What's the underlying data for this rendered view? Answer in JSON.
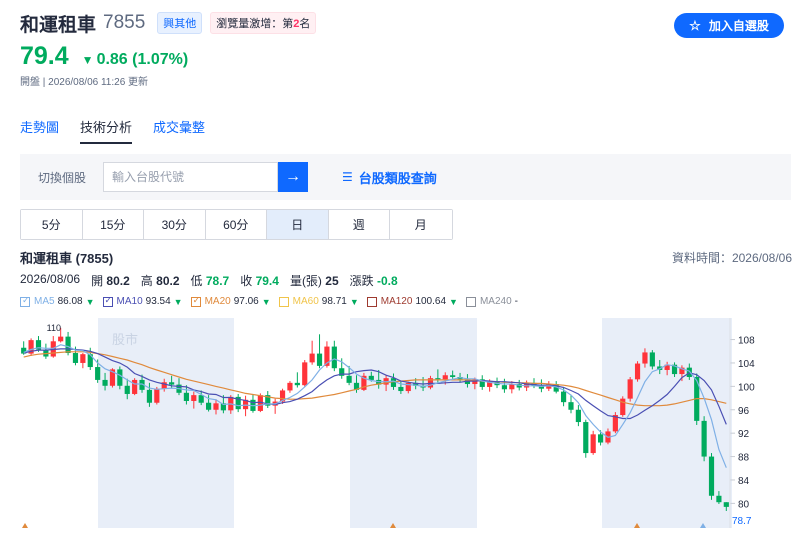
{
  "header": {
    "name": "和運租車",
    "code": "7855",
    "sector_tag": "興其他",
    "hot_prefix": "瀏覽量激增：第",
    "hot_rank": "2",
    "hot_suffix": "名",
    "watch_label": "加入自選股",
    "watch_icon": "star-icon",
    "price": "79.4",
    "change_arrow": "▼",
    "change": "0.86 (1.07%)",
    "update": "開盤 | 2026/08/06 11:26 更新"
  },
  "tabs": [
    {
      "label": "走勢圖",
      "active": false
    },
    {
      "label": "技術分析",
      "active": true
    },
    {
      "label": "成交彙整",
      "active": false
    }
  ],
  "search": {
    "label": "切換個股",
    "placeholder": "輸入台股代號",
    "button_icon": "arrow-right-icon",
    "category_link": "台股類股查詢"
  },
  "periods": [
    {
      "label": "5分",
      "active": false
    },
    {
      "label": "15分",
      "active": false
    },
    {
      "label": "30分",
      "active": false
    },
    {
      "label": "60分",
      "active": false
    },
    {
      "label": "日",
      "active": true
    },
    {
      "label": "週",
      "active": false
    },
    {
      "label": "月",
      "active": false
    }
  ],
  "chart_info": {
    "title": "和運租車 (7855)",
    "data_time": "資料時間：2026/08/06",
    "date": "2026/08/06",
    "open_label": "開",
    "open": "80.2",
    "high_label": "高",
    "high": "80.2",
    "low_label": "低",
    "low": "78.7",
    "close_label": "收",
    "close": "79.4",
    "volume_label": "量(張)",
    "volume": "25",
    "change_label": "漲跌",
    "change": "-0.8"
  },
  "ma_legend": [
    {
      "name": "MA5",
      "value": "86.08",
      "arrow": "▼",
      "color": "#7fb0e6",
      "checked": true
    },
    {
      "name": "MA10",
      "value": "93.54",
      "arrow": "▼",
      "color": "#4a4fb3",
      "checked": true
    },
    {
      "name": "MA20",
      "value": "97.06",
      "arrow": "▼",
      "color": "#e08a3c",
      "checked": true
    },
    {
      "name": "MA60",
      "value": "98.71",
      "arrow": "▼",
      "color": "#f0c44a",
      "checked": false
    },
    {
      "name": "MA120",
      "value": "100.64",
      "arrow": "▼",
      "color": "#9e3a2f",
      "checked": false
    },
    {
      "name": "MA240",
      "value": "-",
      "arrow": "",
      "color": "#8a8f99",
      "checked": false
    }
  ],
  "colors": {
    "up": "#ff333a",
    "down": "#00ab5e",
    "accent": "#0f69ff",
    "band": "#e8eef8"
  },
  "chart_data": {
    "type": "candlestick",
    "y_ticks": [
      "108",
      "104",
      "100",
      "96",
      "92",
      "88",
      "84",
      "80"
    ],
    "ylim": [
      77.5,
      111
    ],
    "last_label": "78.7",
    "max_label": "110",
    "watermark": "股市",
    "candles": [
      [
        106.6,
        107.7,
        105.4,
        105.6
      ],
      [
        105.6,
        108.2,
        105.2,
        107.9
      ],
      [
        107.9,
        108.6,
        105.9,
        106.3
      ],
      [
        106.3,
        107.3,
        104.7,
        105.1
      ],
      [
        105.1,
        108.6,
        104.9,
        107.7
      ],
      [
        107.7,
        110.0,
        107.5,
        108.5
      ],
      [
        108.5,
        109.3,
        105.3,
        105.7
      ],
      [
        105.7,
        106.8,
        103.6,
        104.0
      ],
      [
        104.0,
        105.7,
        103.1,
        105.5
      ],
      [
        105.5,
        106.6,
        102.8,
        103.3
      ],
      [
        103.3,
        104.6,
        100.6,
        101.1
      ],
      [
        101.1,
        102.3,
        99.3,
        100.1
      ],
      [
        100.1,
        103.1,
        99.8,
        102.9
      ],
      [
        102.9,
        103.4,
        99.5,
        100.1
      ],
      [
        100.1,
        101.3,
        97.8,
        98.7
      ],
      [
        98.7,
        101.4,
        98.5,
        101.1
      ],
      [
        101.1,
        102.0,
        98.9,
        99.4
      ],
      [
        99.4,
        100.6,
        96.5,
        97.2
      ],
      [
        97.2,
        99.9,
        96.9,
        99.6
      ],
      [
        99.6,
        101.3,
        99.1,
        100.7
      ],
      [
        100.7,
        101.8,
        99.8,
        100.3
      ],
      [
        100.3,
        101.4,
        98.5,
        98.9
      ],
      [
        98.9,
        100.2,
        96.9,
        97.5
      ],
      [
        97.5,
        99.1,
        96.2,
        98.5
      ],
      [
        98.5,
        99.3,
        96.8,
        97.2
      ],
      [
        97.2,
        98.5,
        95.7,
        96.0
      ],
      [
        96.0,
        97.8,
        95.2,
        97.1
      ],
      [
        97.1,
        98.5,
        95.4,
        95.9
      ],
      [
        95.9,
        98.5,
        95.3,
        98.2
      ],
      [
        98.2,
        98.7,
        95.6,
        96.1
      ],
      [
        96.1,
        98.4,
        94.9,
        97.7
      ],
      [
        97.7,
        98.6,
        95.5,
        95.8
      ],
      [
        95.8,
        98.8,
        95.6,
        98.5
      ],
      [
        98.5,
        99.2,
        96.3,
        96.7
      ],
      [
        96.7,
        97.9,
        95.3,
        97.4
      ],
      [
        97.4,
        99.6,
        97.0,
        99.3
      ],
      [
        99.3,
        100.9,
        98.9,
        100.6
      ],
      [
        100.6,
        102.4,
        99.8,
        100.2
      ],
      [
        100.2,
        104.5,
        99.9,
        104.1
      ],
      [
        104.1,
        107.8,
        103.7,
        105.6
      ],
      [
        105.6,
        108.9,
        103.1,
        103.5
      ],
      [
        103.5,
        107.7,
        103.2,
        106.8
      ],
      [
        106.8,
        107.8,
        102.6,
        103.1
      ],
      [
        103.1,
        104.8,
        101.3,
        101.8
      ],
      [
        101.8,
        103.5,
        100.2,
        100.6
      ],
      [
        100.6,
        101.9,
        98.9,
        99.4
      ],
      [
        99.4,
        102.3,
        99.2,
        101.8
      ],
      [
        101.8,
        102.5,
        100.8,
        101.1
      ],
      [
        101.1,
        102.8,
        99.6,
        100.3
      ],
      [
        100.3,
        101.9,
        99.2,
        101.4
      ],
      [
        101.4,
        102.2,
        99.4,
        99.9
      ],
      [
        99.9,
        101.0,
        98.7,
        99.2
      ],
      [
        99.2,
        100.8,
        98.8,
        100.6
      ],
      [
        100.6,
        101.4,
        99.5,
        100.1
      ],
      [
        100.1,
        101.6,
        99.2,
        99.8
      ],
      [
        99.8,
        101.8,
        99.5,
        101.4
      ],
      [
        101.4,
        102.9,
        100.6,
        101.2
      ],
      [
        101.2,
        102.4,
        100.3,
        101.9
      ],
      [
        101.9,
        102.7,
        101.3,
        101.6
      ],
      [
        101.6,
        102.3,
        100.7,
        101.2
      ],
      [
        101.2,
        102.1,
        99.8,
        100.4
      ],
      [
        100.4,
        101.5,
        99.5,
        101.2
      ],
      [
        101.2,
        101.9,
        99.4,
        99.9
      ],
      [
        99.9,
        101.2,
        99.1,
        100.8
      ],
      [
        100.8,
        101.5,
        99.7,
        100.2
      ],
      [
        100.2,
        101.3,
        98.9,
        99.5
      ],
      [
        99.5,
        100.9,
        98.8,
        100.4
      ],
      [
        100.4,
        101.1,
        99.3,
        99.8
      ],
      [
        99.8,
        101.0,
        99.2,
        100.6
      ],
      [
        100.6,
        101.4,
        99.7,
        100.1
      ],
      [
        100.1,
        101.2,
        99.0,
        99.6
      ],
      [
        99.6,
        100.9,
        99.2,
        100.4
      ],
      [
        100.4,
        100.9,
        98.8,
        99.1
      ],
      [
        99.1,
        99.9,
        96.6,
        97.3
      ],
      [
        97.3,
        98.6,
        95.4,
        96.0
      ],
      [
        96.0,
        96.8,
        93.2,
        93.9
      ],
      [
        93.9,
        94.3,
        87.8,
        88.6
      ],
      [
        88.6,
        92.4,
        88.3,
        91.8
      ],
      [
        91.8,
        92.5,
        89.9,
        90.4
      ],
      [
        90.4,
        92.8,
        90.1,
        92.3
      ],
      [
        92.3,
        95.6,
        92.0,
        95.1
      ],
      [
        95.1,
        98.3,
        94.8,
        97.9
      ],
      [
        97.9,
        101.6,
        97.4,
        101.2
      ],
      [
        101.2,
        104.3,
        100.8,
        103.9
      ],
      [
        103.9,
        106.5,
        103.2,
        105.8
      ],
      [
        105.8,
        106.2,
        102.9,
        103.4
      ],
      [
        103.4,
        104.5,
        102.1,
        102.8
      ],
      [
        102.8,
        104.2,
        101.9,
        103.7
      ],
      [
        103.7,
        104.1,
        101.6,
        102.1
      ],
      [
        102.1,
        103.6,
        100.9,
        103.2
      ],
      [
        103.2,
        103.9,
        101.1,
        101.6
      ],
      [
        101.6,
        102.2,
        93.4,
        94.1
      ],
      [
        94.1,
        94.9,
        87.2,
        88.0
      ],
      [
        88.0,
        88.6,
        80.6,
        81.3
      ],
      [
        81.3,
        82.1,
        79.9,
        80.2
      ],
      [
        80.2,
        80.2,
        78.7,
        79.4
      ]
    ],
    "ma5": [
      105.8,
      106.3,
      106.6,
      106.5,
      106.5,
      107.1,
      106.8,
      106.2,
      106.1,
      105.4,
      104.0,
      103.0,
      102.5,
      101.9,
      101.1,
      100.4,
      100.4,
      99.7,
      99.5,
      99.6,
      99.7,
      99.6,
      99.4,
      99.3,
      98.6,
      97.9,
      97.7,
      96.9,
      97.0,
      96.7,
      96.8,
      96.7,
      96.8,
      97.0,
      97.0,
      97.6,
      98.1,
      98.8,
      99.9,
      101.1,
      102.8,
      104.0,
      104.7,
      104.2,
      103.2,
      102.1,
      101.4,
      101.0,
      100.8,
      100.8,
      100.9,
      100.4,
      100.3,
      100.2,
      100.0,
      100.2,
      100.6,
      100.9,
      101.2,
      101.5,
      101.3,
      101.3,
      100.9,
      100.7,
      100.5,
      100.4,
      100.4,
      100.2,
      100.1,
      100.1,
      100.0,
      100.1,
      99.9,
      99.4,
      98.5,
      97.2,
      95.0,
      93.5,
      92.2,
      91.3,
      91.6,
      93.5,
      95.5,
      98.1,
      100.8,
      102.5,
      103.0,
      103.7,
      103.5,
      103.0,
      102.6,
      101.0,
      98.0,
      94.3,
      89.2,
      86.1
    ],
    "ma10": [
      105.7,
      106.0,
      106.2,
      106.2,
      106.3,
      106.4,
      106.4,
      106.3,
      106.2,
      106.0,
      105.6,
      105.0,
      104.4,
      104.0,
      103.3,
      102.2,
      101.7,
      101.1,
      100.7,
      100.4,
      100.1,
      100.0,
      99.9,
      99.4,
      99.1,
      98.7,
      98.6,
      98.1,
      98.1,
      97.8,
      97.6,
      97.2,
      97.3,
      97.0,
      96.9,
      97.2,
      97.4,
      97.8,
      98.4,
      99.1,
      100.2,
      101.1,
      101.8,
      102.1,
      102.1,
      102.5,
      102.7,
      102.8,
      102.5,
      101.9,
      101.5,
      100.9,
      100.7,
      100.5,
      100.4,
      100.5,
      100.5,
      100.6,
      100.7,
      100.7,
      100.9,
      100.9,
      101.0,
      100.9,
      100.8,
      100.8,
      100.7,
      100.6,
      100.4,
      100.3,
      100.2,
      100.2,
      100.1,
      99.8,
      99.3,
      98.7,
      97.6,
      96.7,
      95.8,
      95.0,
      94.8,
      94.5,
      94.5,
      95.1,
      95.9,
      96.7,
      97.6,
      98.6,
      100.0,
      101.5,
      102.3,
      102.0,
      101.0,
      99.4,
      96.6,
      93.5
    ],
    "ma20": [
      105.0,
      105.3,
      105.5,
      105.6,
      105.7,
      105.8,
      105.9,
      105.9,
      105.9,
      105.8,
      105.6,
      105.4,
      105.1,
      104.8,
      104.5,
      104.1,
      103.7,
      103.2,
      102.8,
      102.4,
      102.0,
      101.6,
      101.2,
      100.9,
      100.6,
      100.3,
      100.0,
      99.7,
      99.4,
      99.1,
      98.8,
      98.6,
      98.4,
      98.2,
      98.0,
      97.9,
      97.8,
      97.8,
      97.9,
      98.0,
      98.2,
      98.4,
      98.6,
      98.9,
      99.2,
      99.5,
      99.9,
      100.2,
      100.4,
      100.6,
      100.8,
      100.9,
      101.0,
      101.1,
      101.1,
      101.1,
      101.1,
      101.1,
      101.1,
      101.1,
      101.1,
      101.0,
      100.9,
      100.8,
      100.8,
      100.7,
      100.7,
      100.6,
      100.6,
      100.5,
      100.5,
      100.4,
      100.3,
      100.2,
      100.0,
      99.7,
      99.3,
      98.9,
      98.5,
      98.1,
      97.7,
      97.3,
      97.0,
      96.8,
      96.7,
      96.7,
      96.7,
      96.8,
      97.0,
      97.3,
      97.6,
      97.9,
      97.9,
      97.7,
      97.4,
      97.1
    ]
  }
}
